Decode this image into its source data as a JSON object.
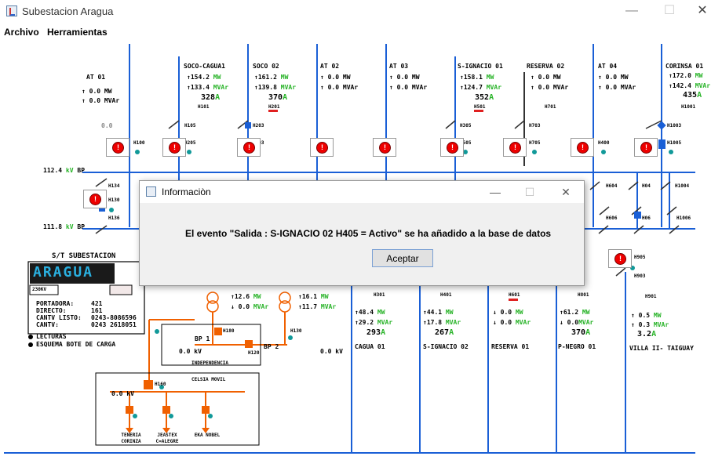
{
  "window": {
    "title": "Subestacion Aragua",
    "controls": [
      "—",
      "☐",
      "✕"
    ]
  },
  "menu": [
    "Archivo",
    "Herramientas"
  ],
  "colors": {
    "bus": "#1a5fd6",
    "alarm": "#e00000",
    "transformer": "#f06000",
    "value_green": "#27b327"
  },
  "feeders_top": [
    {
      "name": "AT 01",
      "mw": "0.0",
      "mvar": "0.0",
      "id": "H180"
    },
    {
      "name": "SOCO-CAGUA1",
      "mw": "154.2",
      "mvar": "133.4",
      "amp": "328",
      "id": "H101"
    },
    {
      "name": "SOCO 02",
      "mw": "161.2",
      "mvar": "139.8",
      "amp": "370",
      "id": "H201"
    },
    {
      "name": "AT 02",
      "mw": "0.0",
      "mvar": "0.0"
    },
    {
      "name": "AT 03",
      "mw": "0.0",
      "mvar": "0.0"
    },
    {
      "name": "S-IGNACIO 01",
      "mw": "158.1",
      "mvar": "124.7",
      "amp": "352",
      "id": "H501"
    },
    {
      "name": "RESERVA 02",
      "mw": "0.0",
      "mvar": "0.0",
      "id": "H701"
    },
    {
      "name": "AT 04",
      "mw": "0.0",
      "mvar": "0.0"
    },
    {
      "name": "CORINSA 01",
      "mw": "172.0",
      "mvar": "142.4",
      "amp": "435",
      "id": "H1001"
    }
  ],
  "switch_labels": [
    "H100",
    "H105",
    "H203",
    "H205",
    "H303",
    "H305",
    "H505",
    "H703",
    "H705",
    "H400",
    "H1003",
    "H1005"
  ],
  "bus_labels": [
    {
      "kv": "112.4",
      "unit": "kV",
      "name": "BP"
    },
    {
      "kv": "111.8",
      "unit": "kV",
      "name": "BP"
    }
  ],
  "left_switches": [
    "H134",
    "H130",
    "H136"
  ],
  "right_switches": [
    "H604",
    "H04",
    "H1004",
    "H606",
    "H06",
    "H1006",
    "H905",
    "H903"
  ],
  "zero_label": "0.0",
  "station": {
    "header": "S/T SUBESTACION",
    "name": "ARAGUA",
    "voltage_tag": "230KV",
    "legend": [
      {
        "label": "PORTADORA:",
        "value": "421"
      },
      {
        "label": "DIRECTO:",
        "value": "161"
      },
      {
        "label": "CANTV LISTO:",
        "value": "0243-8086596"
      },
      {
        "label": "CANTV:",
        "value": "0243 2618051"
      }
    ],
    "notes": [
      "LECTURAS",
      "ESQUEMA BOTE DE CARGA"
    ]
  },
  "transformers": [
    {
      "mw": "12.6",
      "mvar": "0.0"
    },
    {
      "mw": "16.1",
      "mvar": "11.7"
    }
  ],
  "bp_labels": [
    "BP 1",
    "BP 2"
  ],
  "lower_kv": [
    "0.0 kV",
    "0.0 kV",
    "0.0 kV"
  ],
  "lower_ids": [
    "H180",
    "H120",
    "H130",
    "H160"
  ],
  "panels": [
    "INDEPENDENCIA",
    "CELSIA MOVIL"
  ],
  "loads": [
    "TENERIA CORINZA",
    "JEASTEX C=ALEGRE",
    "EKA NOBEL"
  ],
  "feeders_bottom": [
    {
      "name": "CAGUA 01",
      "mw": "48.4",
      "mvar": "29.2",
      "amp": "293",
      "id": "H301"
    },
    {
      "name": "S-IGNACIO 02",
      "mw": "44.1",
      "mvar": "17.8",
      "amp": "267",
      "id": "H401"
    },
    {
      "name": "RESERVA 01",
      "mw": "0.0",
      "mvar": "0.0",
      "id": "H601"
    },
    {
      "name": "P-NEGRO 01",
      "mw": "61.2",
      "mvar": "0.0",
      "amp": "370",
      "id": "H801"
    },
    {
      "name": "VILLA II- TAIGUAY",
      "mw": "0.5",
      "mvar": "0.3",
      "amp": "3.2",
      "id": "H901"
    }
  ],
  "dialog": {
    "title": "Informaciòn",
    "message": "El evento \"Salida : S-IGNACIO 02 H405 = Activo\" se ha añadido a la base de datos",
    "button": "Aceptar"
  }
}
